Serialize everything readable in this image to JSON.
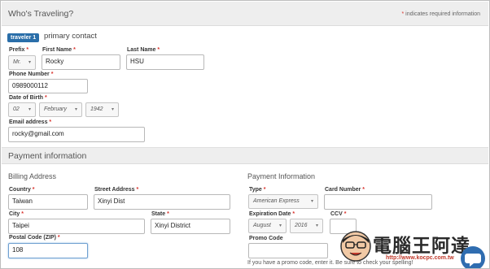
{
  "travelers": {
    "section_title": "Who's Traveling?",
    "required_note": "indicates required information",
    "required_mark": "*",
    "badge": "traveler 1",
    "badge_text": "primary contact",
    "fields": {
      "prefix_label": "Prefix",
      "prefix_value": "Mr.",
      "first_name_label": "First Name",
      "first_name_value": "Rocky",
      "last_name_label": "Last Name",
      "last_name_value": "HSU",
      "phone_label": "Phone Number",
      "phone_value": "0989000112",
      "dob_label": "Date of Birth",
      "dob_day": "02",
      "dob_month": "February",
      "dob_year": "1942",
      "email_label": "Email address",
      "email_value": "rocky@gmail.com"
    }
  },
  "payment": {
    "section_title": "Payment information",
    "billing": {
      "title": "Billing Address",
      "country_label": "Country",
      "country_value": "Taiwan",
      "street_label": "Street Address",
      "street_value": "Xinyi Dist",
      "city_label": "City",
      "city_value": "Taipei",
      "state_label": "State",
      "state_value": "Xinyi District",
      "zip_label": "Postal Code (ZIP)",
      "zip_value": "108"
    },
    "card": {
      "title": "Payment Information",
      "type_label": "Type",
      "type_value": "American Express",
      "card_number_label": "Card Number",
      "card_number_value": "",
      "expiration_label": "Expiration Date",
      "exp_month": "August",
      "exp_year": "2016",
      "ccv_label": "CCV",
      "ccv_value": "",
      "promo_label": "Promo Code",
      "promo_value": "",
      "promo_hint": "If you have a promo code, enter it. Be sure to check your spelling!"
    }
  },
  "watermark": {
    "text": "電腦王阿達",
    "url": "http://www.kocpc.com.tw"
  },
  "icons": {
    "caret": "chevron-down-icon",
    "avatar": "mascot-avatar-icon",
    "chat": "chat-bubble-icon"
  },
  "colors": {
    "accent": "#2a6ea9",
    "required": "#d9312b",
    "section_bg": "#eeeeee",
    "chat": "#2f6db0"
  }
}
